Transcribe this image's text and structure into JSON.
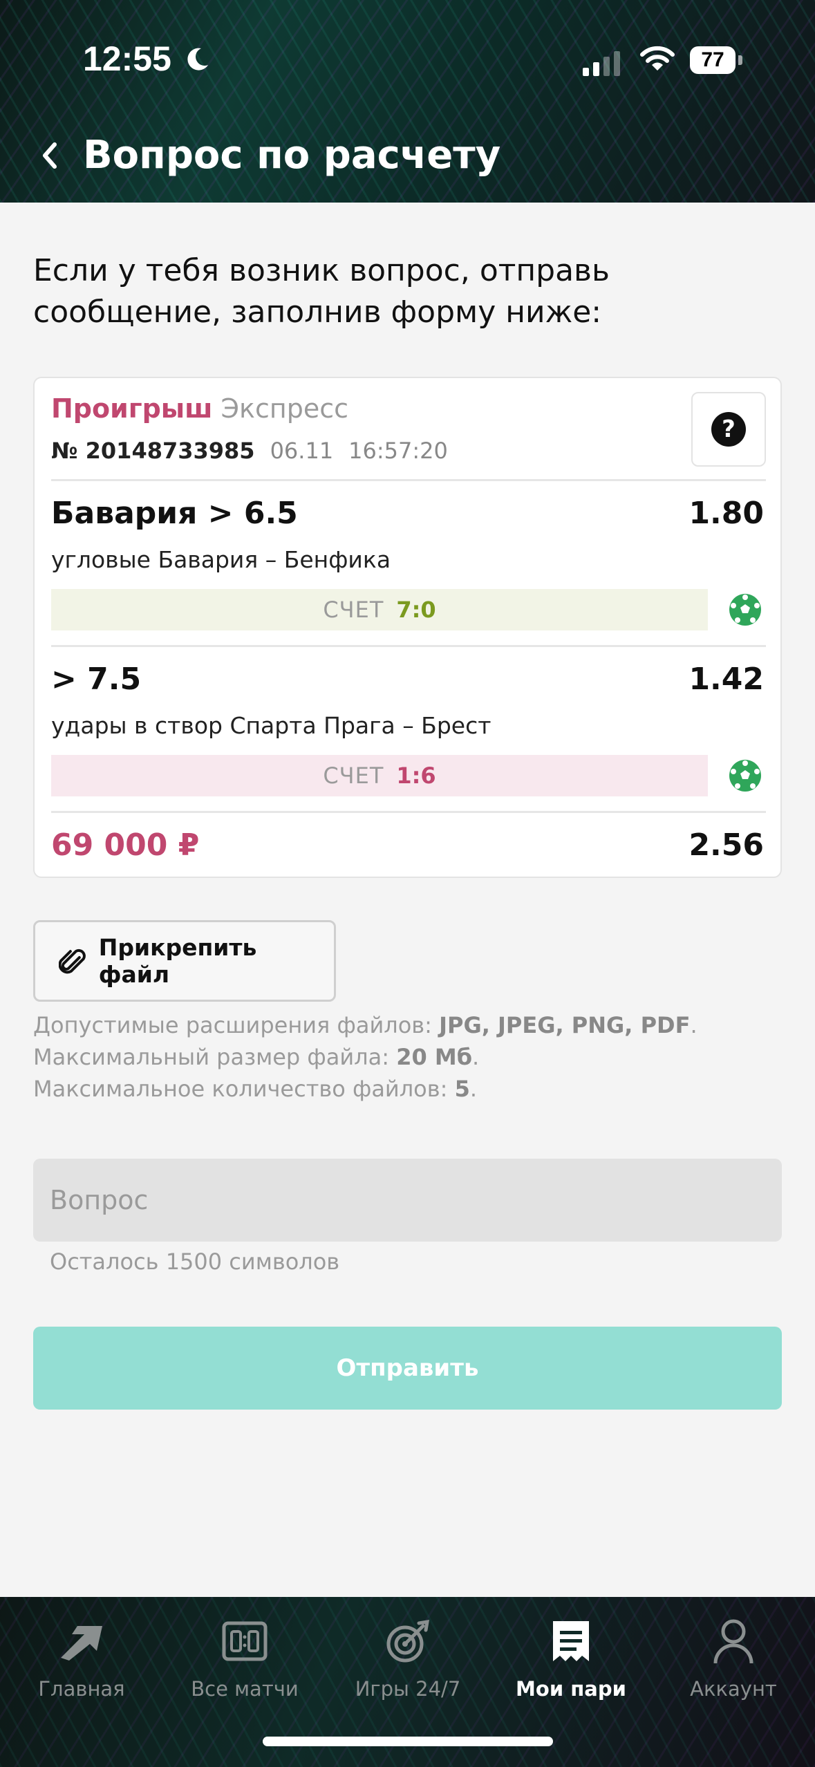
{
  "status_bar": {
    "time": "12:55",
    "battery": "77"
  },
  "header": {
    "title": "Вопрос по расчету"
  },
  "intro_text": "Если у тебя возник вопрос, отправь сообщение, заполнив форму ниже:",
  "bet": {
    "status": "Проигрыш",
    "type": "Экспресс",
    "number": "№ 20148733985",
    "date": "06.11",
    "time": "16:57:20",
    "events": [
      {
        "title": "Бавария > 6.5",
        "odds": "1.80",
        "subtitle": "угловые Бавария – Бенфика",
        "score_label": "СЧЕТ",
        "score": "7:0"
      },
      {
        "title": "> 7.5",
        "odds": "1.42",
        "subtitle": "удары в створ Спарта Прага – Брест",
        "score_label": "СЧЕТ",
        "score": "1:6"
      }
    ],
    "stake": "69 000 ₽",
    "total_odds": "2.56"
  },
  "attach": {
    "label": "Прикрепить файл",
    "ext_text": "Допустимые расширения файлов: ",
    "ext_value": "JPG, JPEG, PNG, PDF",
    "size_text": "Максимальный размер файла: ",
    "size_value": "20 Мб",
    "count_text": "Максимальное количество файлов: ",
    "count_value": "5"
  },
  "question": {
    "placeholder": "Вопрос",
    "chars_left": "Осталось 1500 символов"
  },
  "submit_label": "Отправить",
  "tabs": [
    {
      "label": "Главная",
      "icon": "arrow-logo-icon"
    },
    {
      "label": "Все матчи",
      "icon": "scoreboard-icon"
    },
    {
      "label": "Игры 24/7",
      "icon": "target-icon"
    },
    {
      "label": "Мои пари",
      "icon": "receipt-icon",
      "active": true
    },
    {
      "label": "Аккаунт",
      "icon": "user-icon"
    }
  ],
  "colors": {
    "loss": "#c0476f",
    "win": "#7b9a1f",
    "submit_bg": "#93ded3",
    "ball": "#2fa65a"
  }
}
